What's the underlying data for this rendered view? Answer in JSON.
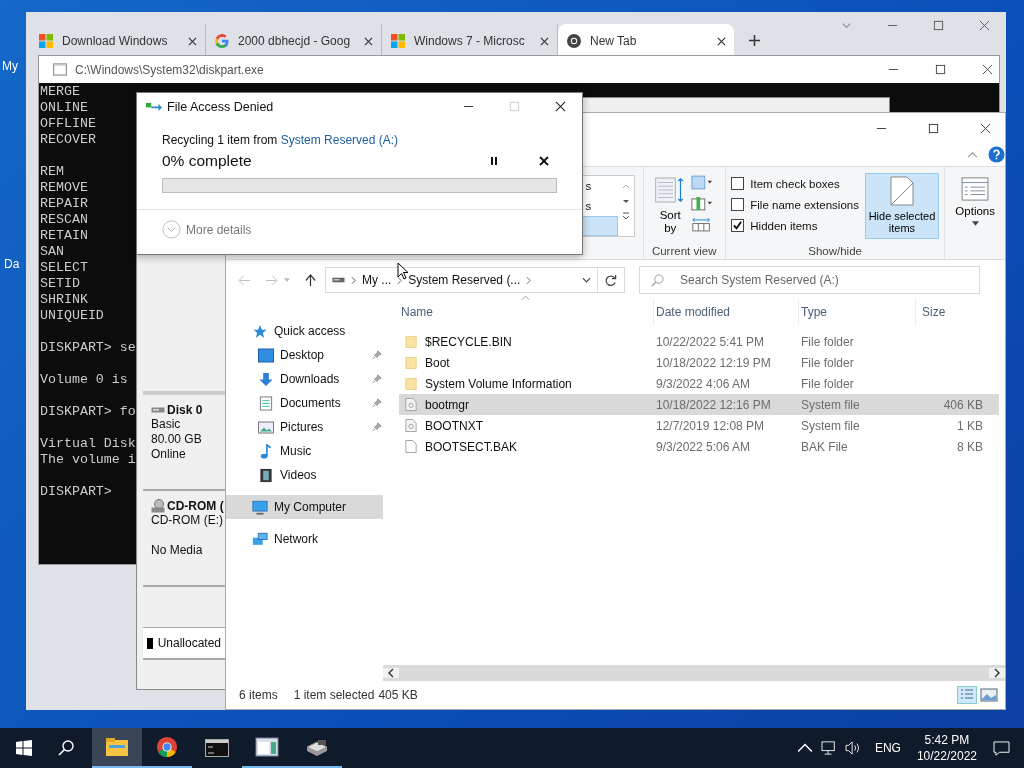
{
  "desktop": {
    "icon_labels": [
      "My",
      "Da"
    ]
  },
  "browser": {
    "tabs": [
      {
        "label": "Download Windows",
        "kind": "windows",
        "selected": false
      },
      {
        "label": "2000 dbhecjd - Goog",
        "kind": "google",
        "selected": false
      },
      {
        "label": "Windows 7 - Microsc",
        "kind": "windows",
        "selected": false
      },
      {
        "label": "New Tab",
        "kind": "chrome",
        "selected": true
      }
    ]
  },
  "console": {
    "title": "C:\\Windows\\System32\\diskpart.exe",
    "blocks": [
      [
        {
          "text": "MERGE"
        },
        {
          "text": "ONLINE"
        },
        {
          "text": "OFFLINE"
        },
        {
          "text": "RECOVER"
        }
      ],
      [
        {
          "text": "REM"
        },
        {
          "text": "REMOVE"
        },
        {
          "text": "REPAIR"
        },
        {
          "text": "RESCAN"
        },
        {
          "text": "RETAIN"
        },
        {
          "text": "SAN"
        },
        {
          "text": "SELECT"
        },
        {
          "text": "SETID"
        },
        {
          "text": "SHRINK"
        },
        {
          "text": "UNIQUEID"
        }
      ],
      [
        {
          "text": "DISKPART> se"
        }
      ],
      [
        {
          "text": "Volume 0 is"
        }
      ],
      [
        {
          "text": "DISKPART> fo"
        }
      ],
      [
        {
          "text": "Virtual Disk"
        },
        {
          "text": "The volume i"
        }
      ],
      [
        {
          "text": "DISKPART>"
        }
      ]
    ]
  },
  "disk_management": {
    "disks": [
      {
        "name": "Disk 0",
        "kind": "disk",
        "lines": [
          "Basic",
          "80.00 GB",
          "Online"
        ]
      },
      {
        "name": "CD-ROM (",
        "kind": "cdrom",
        "lines": [
          "CD-ROM (E:)",
          "No Media"
        ]
      }
    ],
    "legend": "Unallocated"
  },
  "dialog": {
    "title": "File Access Denied",
    "message": "Recycling 1 item from",
    "source": "System Reserved (A:)",
    "progress_text": "0% complete",
    "level": 0,
    "details": "More details"
  },
  "explorer": {
    "ribbon": {
      "layout_items": [
        {
          "label": "s",
          "selected": false
        },
        {
          "label": "s",
          "selected": false
        },
        {
          "selected": true
        }
      ],
      "sort_label": "Sort by",
      "current_view_label": "Current view",
      "checkboxes": [
        {
          "label": "Item check boxes",
          "checked": false
        },
        {
          "label": "File name extensions",
          "checked": false
        },
        {
          "label": "Hidden items",
          "checked": true
        }
      ],
      "hide_button": {
        "label": "Hide selected items",
        "selected": true
      },
      "show_hide_label": "Show/hide",
      "options_label": "Options"
    },
    "address": {
      "crumbs": [
        "My ...",
        "System Reserved (..."
      ]
    },
    "search": {
      "placeholder": "Search System Reserved (A:)"
    },
    "nav": [
      {
        "label": "Quick access",
        "kind": "star",
        "selected": false,
        "children": [
          {
            "label": "Desktop",
            "kind": "desktop",
            "pinned": true,
            "selected": false
          },
          {
            "label": "Downloads",
            "kind": "download",
            "pinned": true,
            "selected": false
          },
          {
            "label": "Documents",
            "kind": "document",
            "pinned": true,
            "selected": false
          },
          {
            "label": "Pictures",
            "kind": "pictures",
            "pinned": true,
            "selected": false
          },
          {
            "label": "Music",
            "kind": "music",
            "pinned": false,
            "selected": false
          },
          {
            "label": "Videos",
            "kind": "videos",
            "pinned": false,
            "selected": false
          }
        ]
      },
      {
        "label": "My Computer",
        "kind": "computer",
        "selected": true
      },
      {
        "label": "Network",
        "kind": "network",
        "selected": false
      }
    ],
    "columns": [
      "Name",
      "Date modified",
      "Type",
      "Size"
    ],
    "files": [
      {
        "name": "$RECYCLE.BIN",
        "date": "10/22/2022 5:41 PM",
        "type": "File folder",
        "kind": "folder",
        "selected": false
      },
      {
        "name": "Boot",
        "date": "10/18/2022 12:19 PM",
        "type": "File folder",
        "kind": "folder",
        "selected": false
      },
      {
        "name": "System Volume Information",
        "date": "9/3/2022 4:06 AM",
        "type": "File folder",
        "kind": "folder",
        "selected": false
      },
      {
        "name": "bootmgr",
        "date": "10/18/2022 12:16 PM",
        "type": "System file",
        "size": "406 KB",
        "kind": "system",
        "selected": true
      },
      {
        "name": "BOOTNXT",
        "date": "12/7/2019 12:08 PM",
        "type": "System file",
        "size": "1 KB",
        "kind": "system",
        "selected": false
      },
      {
        "name": "BOOTSECT.BAK",
        "date": "9/3/2022 5:06 AM",
        "type": "BAK File",
        "size": "8 KB",
        "kind": "file",
        "selected": false
      }
    ],
    "status": {
      "count": "6 items",
      "selection": "1 item selected",
      "size": "405 KB"
    }
  },
  "taskbar": {
    "apps": [
      {
        "kind": "explorer",
        "active": true,
        "running": true
      },
      {
        "kind": "chrome",
        "active": false,
        "running": true
      },
      {
        "kind": "console",
        "active": false,
        "running": false
      },
      {
        "kind": "diskmgmt",
        "active": false,
        "running": true
      },
      {
        "kind": "tool",
        "active": false,
        "running": true
      }
    ],
    "language": "ENG",
    "time": "5:42 PM",
    "date": "10/22/2022"
  }
}
